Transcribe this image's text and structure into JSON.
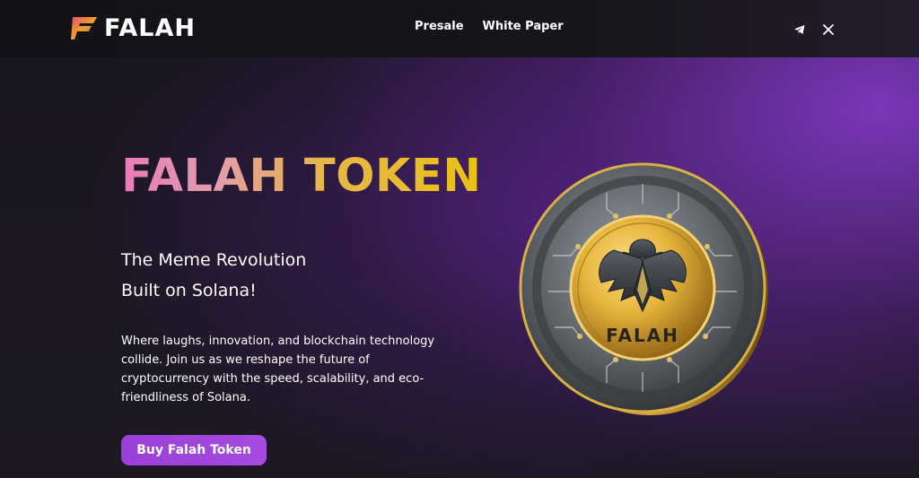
{
  "brand": {
    "name": "FALAH"
  },
  "nav": {
    "items": [
      "Presale",
      "White Paper"
    ]
  },
  "socials": {
    "telegram": "telegram-icon",
    "x": "x-icon"
  },
  "hero": {
    "title": "FALAH TOKEN",
    "subtitle_line1": "The Meme Revolution",
    "subtitle_line2": "Built on Solana!",
    "description": "Where laughs, innovation, and blockchain technology collide. Join us as we reshape the future of cryptocurrency with the speed, scalability, and eco-friendliness of Solana.",
    "cta_label": "Buy Falah Token",
    "coin_text": "FALAH"
  },
  "colors": {
    "accent": "#9a3fd9",
    "title_gradient_start": "#e87ab8",
    "title_gradient_end": "#e9c112",
    "background": "#17141c"
  }
}
